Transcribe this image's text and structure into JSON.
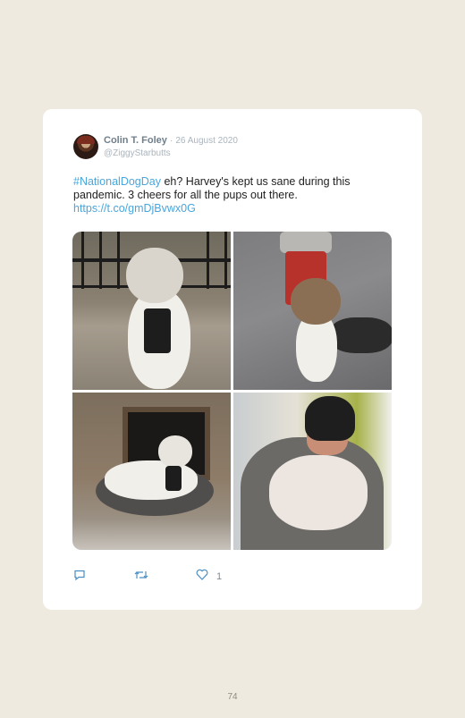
{
  "tweet": {
    "author_name": "Colin T. Foley",
    "separator": "·",
    "date": "26 August 2020",
    "handle": "@ZiggyStarbutts",
    "text": {
      "hashtag": "#NationalDogDay",
      "body": " eh? Harvey's kept us sane during this pandemic. 3 cheers for all the pups out there.",
      "link": "https://t.co/gmDjBvwx0G"
    },
    "photos": [
      "dog-photo-railing",
      "dog-photo-hydrant",
      "dog-photo-fireplace",
      "dog-photo-hug"
    ],
    "actions": {
      "reply_icon": "reply-icon",
      "retweet_icon": "retweet-icon",
      "like_icon": "heart-icon",
      "like_count": "1"
    },
    "colors": {
      "link": "#4aa6dc",
      "name": "#6f7f8c",
      "muted": "#aab4bd",
      "page_background": "#eeeae0",
      "card_background": "#ffffff"
    }
  },
  "page": {
    "number": "74"
  }
}
